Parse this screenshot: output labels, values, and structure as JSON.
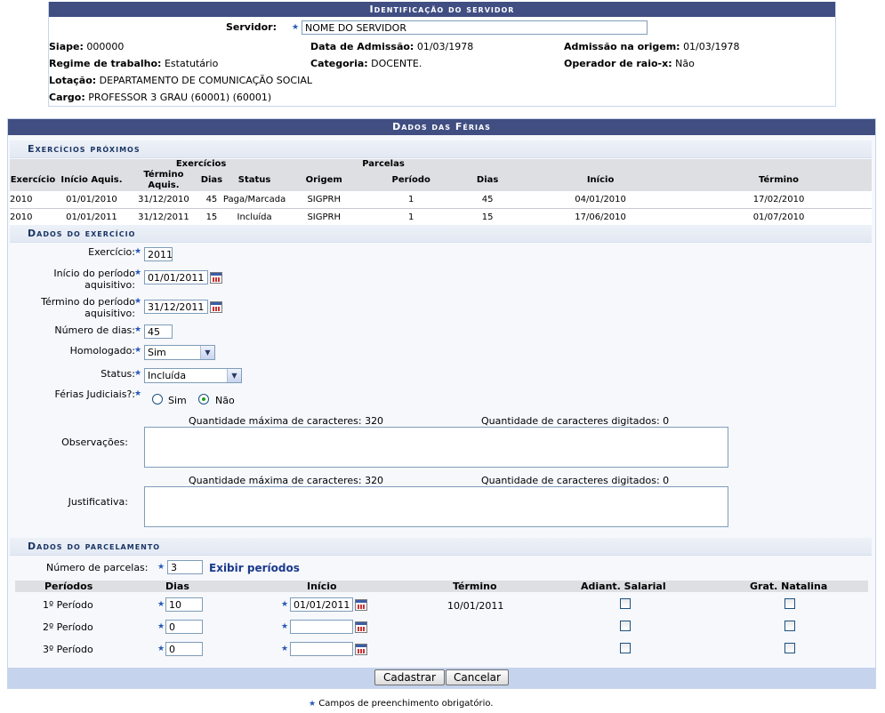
{
  "ident": {
    "title": "Identificação do servidor",
    "servidor_label": "Servidor:",
    "servidor_value": "NOME DO SERVIDOR",
    "siape_label": "Siape:",
    "siape_value": "000000",
    "admissao_label": "Data de Admissão:",
    "admissao_value": "01/03/1978",
    "adm_origem_label": "Admissão na origem:",
    "adm_origem_value": "01/03/1978",
    "regime_label": "Regime de trabalho:",
    "regime_value": "Estatutário",
    "categoria_label": "Categoria:",
    "categoria_value": "DOCENTE.",
    "raiox_label": "Operador de raio-x:",
    "raiox_value": "Não",
    "lotacao_label": "Lotação:",
    "lotacao_value": "DEPARTAMENTO DE COMUNICAÇÃO SOCIAL",
    "cargo_label": "Cargo:",
    "cargo_value": "PROFESSOR 3 GRAU (60001) (60001)"
  },
  "dados": {
    "title": "Dados das Férias",
    "exercicios_title": "Exercícios próximos",
    "ex_group1": "Exercícios",
    "ex_group2": "Parcelas",
    "ex_cols": [
      "Exercício",
      "Início Aquis.",
      "Término Aquis.",
      "Dias",
      "Status",
      "Origem",
      "Período",
      "Dias",
      "Início",
      "Término"
    ],
    "ex_rows": [
      [
        "2010",
        "01/01/2010",
        "31/12/2010",
        "45",
        "Paga/Marcada",
        "SIGPRH",
        "1",
        "45",
        "04/01/2010",
        "17/02/2010"
      ],
      [
        "2010",
        "01/01/2011",
        "31/12/2011",
        "15",
        "Incluída",
        "SIGPRH",
        "1",
        "15",
        "17/06/2010",
        "01/07/2010"
      ]
    ],
    "exercicio_title": "Dados do exercício",
    "exercicio_label": "Exercício:",
    "exercicio_value": "2011",
    "inicio_label1": "Início do período",
    "inicio_label2": "aquisitivo:",
    "inicio_value": "01/01/2011",
    "termino_label1": "Término do período",
    "termino_label2": "aquisitivo:",
    "termino_value": "31/12/2011",
    "num_dias_label": "Número de dias:",
    "num_dias_value": "45",
    "homologado_label": "Homologado:",
    "homologado_value": "Sim",
    "status_label": "Status:",
    "status_value": "Incluída",
    "judiciais_label": "Férias Judiciais?:",
    "judiciais_sim": "Sim",
    "judiciais_nao": "Não",
    "max_chars": "Quantidade máxima de caracteres: 320",
    "typed_chars": "Quantidade de caracteres digitados: 0",
    "obs_label": "Observações:",
    "just_label": "Justificativa:",
    "parcelamento_title": "Dados do parcelamento",
    "num_parcelas_label": "Número de parcelas:",
    "num_parcelas_value": "3",
    "exibir_link": "Exibir períodos",
    "p_cols": [
      "Períodos",
      "Dias",
      "Início",
      "Término",
      "Adiant. Salarial",
      "Grat. Natalina"
    ],
    "periodos": [
      {
        "label": "1º Período",
        "dias": "10",
        "inicio": "01/01/2011",
        "termino": "10/01/2011"
      },
      {
        "label": "2º Período",
        "dias": "0",
        "inicio": "",
        "termino": ""
      },
      {
        "label": "3º Período",
        "dias": "0",
        "inicio": "",
        "termino": ""
      }
    ],
    "cadastrar": "Cadastrar",
    "cancelar": "Cancelar"
  },
  "footer_note": "Campos de preenchimento obrigatório.",
  "required_mark": "★"
}
